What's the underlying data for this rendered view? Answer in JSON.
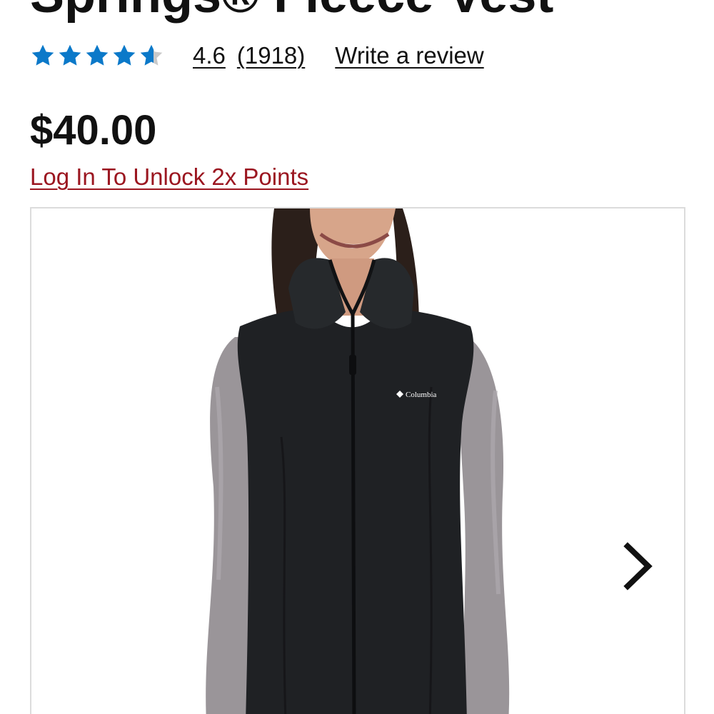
{
  "product": {
    "title": "Springs® Fleece Vest",
    "price": "$40.00"
  },
  "rating": {
    "stars_out_of_5": 4.6,
    "value": "4.6",
    "count": "(1918)",
    "write_review_label": "Write a review"
  },
  "promo": {
    "unlock_label": "Log In To Unlock 2x Points"
  },
  "gallery": {
    "brand_logo_text": "Columbia",
    "next_icon": "chevron-right-icon"
  },
  "colors": {
    "star_fill": "#0b79c9",
    "star_empty": "#c9c9c9",
    "promo_link": "#9b1620",
    "vest": "#1f2124",
    "sleeve": "#9a9599"
  }
}
